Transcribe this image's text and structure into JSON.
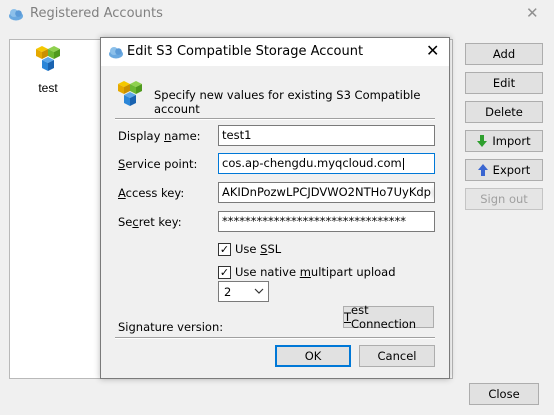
{
  "parent": {
    "title": "Registered Accounts",
    "close_glyph": "✕",
    "accounts": [
      {
        "label": "test",
        "icon": "s3-cubes-icon"
      }
    ],
    "buttons": {
      "add": "Add",
      "edit": "Edit",
      "delete": "Delete",
      "import": "Import",
      "export": "Export",
      "sign_out": "Sign out",
      "close": "Close"
    },
    "colors": {
      "import_arrow": "#2e9f2e",
      "export_arrow": "#3a66d1"
    }
  },
  "dialog": {
    "title": "Edit S3 Compatible Storage Account",
    "close_glyph": "✕",
    "header_text": "Specify new values for existing S3 Compatible account",
    "fields": {
      "display_name": {
        "label_pre": "Display ",
        "label_mnemonic": "n",
        "label_post": "ame:",
        "value": "test1"
      },
      "service_point": {
        "label_pre": "",
        "label_mnemonic": "S",
        "label_post": "ervice point:",
        "value": "cos.ap-chengdu.myqcloud.com"
      },
      "access_key": {
        "label_pre": "",
        "label_mnemonic": "A",
        "label_post": "ccess key:",
        "value": "AKIDnPozwLPCJDVWO2NTHo7UyKdp"
      },
      "secret_key": {
        "label_pre": "Se",
        "label_mnemonic": "c",
        "label_post": "ret key:",
        "value": "********************************"
      }
    },
    "checkboxes": {
      "use_ssl": {
        "label_pre": "Use ",
        "label_mnemonic": "S",
        "label_post": "SL",
        "checked_glyph": "✓"
      },
      "multipart": {
        "label_pre": "Use native ",
        "label_mnemonic": "m",
        "label_post": "ultipart upload",
        "checked_glyph": "✓"
      }
    },
    "signature_version": {
      "label": "Signature version:",
      "value": "2"
    },
    "buttons": {
      "test_connection": {
        "mnemonic": "T",
        "rest": "est Connection"
      },
      "ok": "OK",
      "cancel": "Cancel"
    },
    "colors": {
      "focus_border": "#0078d7",
      "cube_green": "#7cc242",
      "cube_blue": "#2b86d8",
      "cube_yellow": "#f5c800"
    }
  }
}
